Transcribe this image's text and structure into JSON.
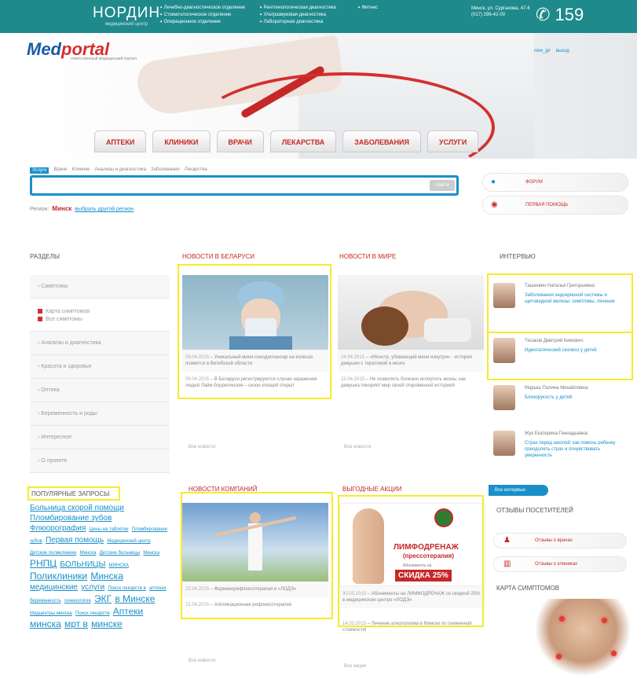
{
  "topbar": {
    "center_name": "НОРДИН",
    "center_sub": "медицинский центр",
    "departments_col1": [
      "Лечебно-диагностическое отделение",
      "Стоматологическое отделение",
      "Операционное отделение"
    ],
    "departments_col2": [
      "Рентгенологическая диагностика",
      "Ультразвуковая диагностика",
      "Лабораторная диагностика"
    ],
    "departments_col3": [
      "Фитнес"
    ],
    "address": "Минск, ул. Сурганова, 47-6",
    "address_phone": "(017) 296-42-00",
    "short_phone": "159"
  },
  "logo": {
    "med": "Med",
    "portal": "portal",
    "tagline": "ответственный медицинский портал"
  },
  "user": {
    "login": "new_jpr",
    "logout": "выход"
  },
  "nav": [
    "АПТЕКИ",
    "КЛИНИКИ",
    "ВРАЧИ",
    "ЛЕКАРСТВА",
    "ЗАБОЛЕВАНИЯ",
    "УСЛУГИ"
  ],
  "search": {
    "tabs": [
      "Услуги",
      "Врачи",
      "Клиники",
      "Анализы и диагностика",
      "Заболевания",
      "Лекарства"
    ],
    "button": "Найти",
    "region_label": "Регион:",
    "region_value": "Минск",
    "region_change": "выбрать другой регион"
  },
  "side_links": {
    "forum": "ФОРУМ",
    "first_aid": "ПЕРВАЯ ПОМОЩЬ"
  },
  "sections": {
    "header": "РАЗДЕЛЫ",
    "items": [
      "Симптомы",
      "Анализы и диагностика",
      "Красота и здоровье",
      "Оптика",
      "Беременность и роды",
      "Интересное",
      "О проекте"
    ],
    "symptom_sub": [
      "Карта симптомов",
      "Все симптомы"
    ]
  },
  "popular": {
    "header": "ПОПУЛЯРНЫЕ ЗАПРОСЫ",
    "tags": [
      {
        "t": "Больница скорой помощи",
        "s": "s1"
      },
      {
        "t": "Пломбирование зубов",
        "s": "s1"
      },
      {
        "t": "Флюорография",
        "s": "s1"
      },
      {
        "t": "Цены на таблетки",
        "s": "s2"
      },
      {
        "t": "Пломбирование зубов",
        "s": "s2"
      },
      {
        "t": "Первая помощь",
        "s": "s1"
      },
      {
        "t": "Медицинский центр",
        "s": "s2"
      },
      {
        "t": "Детские поликлиники",
        "s": "s2"
      },
      {
        "t": "Минска",
        "s": "s2"
      },
      {
        "t": "Детские больницы",
        "s": "s2"
      },
      {
        "t": "Минска",
        "s": "s2"
      },
      {
        "t": "РНПЦ",
        "s": "s3"
      },
      {
        "t": "БОЛЬНИЦЫ",
        "s": "s1"
      },
      {
        "t": "МИНСКА",
        "s": "s2"
      },
      {
        "t": "Поликлиники",
        "s": "s3"
      },
      {
        "t": "Минска",
        "s": "s3"
      },
      {
        "t": "медицинские",
        "s": "s1"
      },
      {
        "t": "услуги",
        "s": "s1"
      },
      {
        "t": "Поиск лекарств в",
        "s": "s2"
      },
      {
        "t": "аптеках",
        "s": "s2"
      },
      {
        "t": "беременность",
        "s": "s2"
      },
      {
        "t": "гинекология",
        "s": "s2"
      },
      {
        "t": "ЭКГ",
        "s": "s3"
      },
      {
        "t": "в Минске",
        "s": "s3"
      },
      {
        "t": "Медцентры минска",
        "s": "s2"
      },
      {
        "t": "Поиск лекарств",
        "s": "s2"
      },
      {
        "t": "Аптеки минска",
        "s": "s3"
      },
      {
        "t": "мрт в",
        "s": "s3"
      },
      {
        "t": "минске",
        "s": "s3"
      }
    ]
  },
  "news_by": {
    "header": "НОВОСТИ В БЕЛАРУСИ",
    "main_date": "09.04.2015",
    "main_title": "Уникальный мини-онкодиспансер на колесах появится в Витебской области",
    "item_date": "09.04.2015",
    "item_title": "В Беларуси регистрируются случаи заражения людей Лайм-боррелиозом – сезон клещей открыт",
    "all": "Все новости"
  },
  "news_world": {
    "header": "НОВОСТИ В МИРЕ",
    "main_date": "24.04.2015",
    "main_title": "«Монстр, убивающий меня изнутри» - история девушки с тератомой в мозге",
    "item_date": "23.04.2015",
    "item_title": "Не позволить болезни испортить жизнь: как девушка покоряет мир своей откровенной историей",
    "all": "Все новости"
  },
  "news_company": {
    "header": "НОВОСТИ КОМПАНИЙ",
    "main_date": "22.04.2015",
    "main_title": "Фармакорефлексотерапия в «ЛОДЭ»",
    "item_date": "21.04.2015",
    "item_title": "Аппликационная рефлексотерапия",
    "all": "Все новости"
  },
  "promo": {
    "header": "ВЫГОДНЫЕ АКЦИИ",
    "banner_title": "ЛИМФОДРЕНАЖ",
    "banner_sub": "(прессотерапия)",
    "banner_discount": "СКИДКА 25%",
    "banner_note": "Абонементы на",
    "main_date": "30.03.2015",
    "main_title": "Абонементы на ЛИМФОДРЕНАЖ со скидкой 25% в медицинском центре «ЛОДЭ»",
    "item_date": "14.02.2015",
    "item_title": "Лечение алкоголизма в Минске по сниженной стоимости!",
    "all": "Все акции"
  },
  "interview": {
    "header": "ИНТЕРВЬЮ",
    "items": [
      {
        "name": "Ташкевич Наталья Григорьевна:",
        "topic": "Заболевания эндокринной системы и щитовидной железы: симптомы, лечение"
      },
      {
        "name": "Тесаков Дмитрий Кимович:",
        "topic": "Идиопатический сколиоз у детей"
      },
      {
        "name": "Марыш Полина Михайловна:",
        "topic": "Близорукость у детей"
      },
      {
        "name": "Жук Екатерина Геннадьевна:",
        "topic": "Страх перед школой: как помочь ребенку преодолеть страх и почувствовать уверенность"
      }
    ],
    "all": "Все интервью"
  },
  "reviews": {
    "header": "ОТЗЫВЫ ПОСЕТИТЕЛЕЙ",
    "doctors": "Отзывы о врачах",
    "clinics": "Отзывы о клиниках"
  },
  "symptom_map": {
    "header": "КАРТА СИМПТОМОВ"
  },
  "colors": {
    "teal": "#1e8a8c",
    "brand_red": "#c62828",
    "link_blue": "#1a8fc9",
    "highlight": "#f5ec2b"
  }
}
